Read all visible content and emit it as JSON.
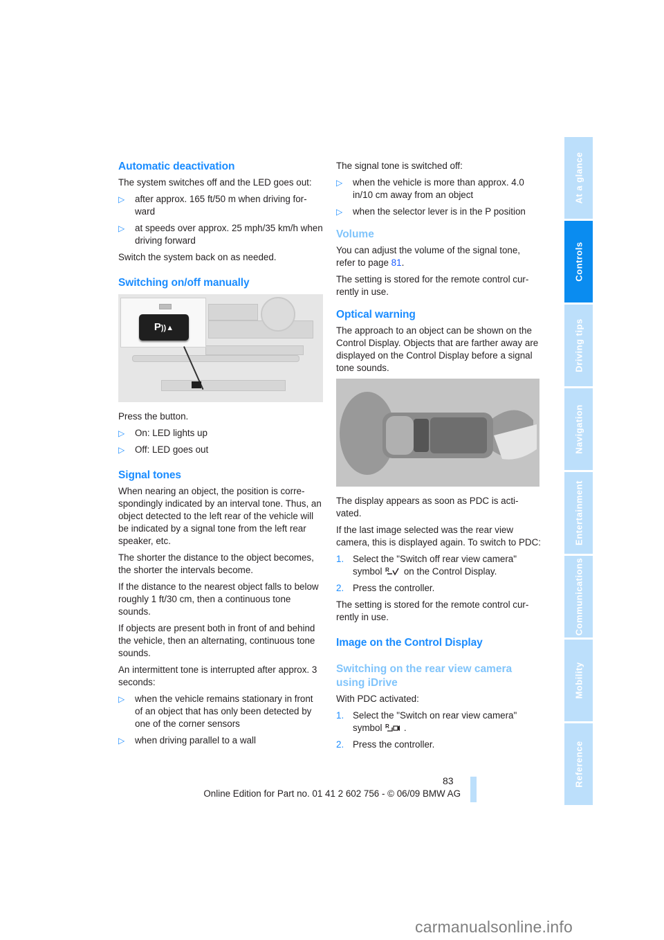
{
  "left_column": {
    "auto_deactivation": {
      "heading": "Automatic deactivation",
      "intro": "The system switches off and the LED goes out:",
      "bullets": [
        "after approx. 165 ft/50 m when driving for-ward",
        "at speeds over approx. 25 mph/35 km/h when driving forward"
      ],
      "outro": "Switch the system back on as needed."
    },
    "manual_switch": {
      "heading": "Switching on/off manually",
      "figure": {
        "button_label": "P",
        "button_icon": "pdc-sensor-icon"
      },
      "intro": "Press the button.",
      "bullets": [
        "On: LED lights up",
        "Off: LED goes out"
      ]
    },
    "signal_tones": {
      "heading": "Signal tones",
      "paragraphs": [
        "When nearing an object, the position is corre-spondingly indicated by an interval tone. Thus, an object detected to the left rear of the vehicle will be indicated by a signal tone from the left rear speaker, etc.",
        "The shorter the distance to the object becomes, the shorter the intervals become.",
        "If the distance to the nearest object falls to below roughly 1 ft/30 cm, then a continuous tone sounds.",
        "If objects are present both in front of and behind the vehicle, then an alternating, continuous tone sounds.",
        "An intermittent tone is interrupted after approx. 3 seconds:"
      ],
      "bullets": [
        "when the vehicle remains stationary in front of an object that has only been detected by one of the corner sensors",
        "when driving parallel to a wall"
      ]
    }
  },
  "right_column": {
    "tone_off": {
      "intro": "The signal tone is switched off:",
      "bullets": [
        "when the vehicle is more than approx. 4.0 in/10 cm away from an object",
        "when the selector lever is in the P position"
      ]
    },
    "volume": {
      "heading": "Volume",
      "text_before": "You can adjust the volume of the signal tone, refer to page ",
      "page_ref": "81",
      "text_after": ".",
      "note": "The setting is stored for the remote control cur-rently in use."
    },
    "optical_warning": {
      "heading": "Optical warning",
      "text": "The approach to an object can be shown on the Control Display. Objects that are farther away are displayed on the Control Display before a signal tone sounds.",
      "after_figure": [
        "The display appears as soon as PDC is acti-vated.",
        "If the last image selected was the rear view camera, this is displayed again. To switch to PDC:"
      ],
      "steps": [
        {
          "num": "1.",
          "before": "Select the \"Switch off rear view camera\" symbol ",
          "icon": "switch-off-camera-icon",
          "after": " on the Control Display."
        },
        {
          "num": "2.",
          "text": "Press the controller."
        }
      ],
      "note": "The setting is stored for the remote control cur-rently in use."
    },
    "control_display_image": {
      "heading": "Image on the Control Display",
      "subheading": "Switching on the rear view camera using iDrive",
      "intro": "With PDC activated:",
      "steps": [
        {
          "num": "1.",
          "before": "Select the \"Switch on rear view camera\" symbol ",
          "icon": "switch-on-camera-icon",
          "after": " ."
        },
        {
          "num": "2.",
          "text": "Press the controller."
        }
      ]
    }
  },
  "side_tabs": [
    {
      "label": "At a glance",
      "active": false
    },
    {
      "label": "Controls",
      "active": true
    },
    {
      "label": "Driving tips",
      "active": false
    },
    {
      "label": "Navigation",
      "active": false
    },
    {
      "label": "Entertainment",
      "active": false
    },
    {
      "label": "Communications",
      "active": false
    },
    {
      "label": "Mobility",
      "active": false
    },
    {
      "label": "Reference",
      "active": false
    }
  ],
  "footer": {
    "page_number": "83",
    "edition": "Online Edition for Part no. 01 41 2 602 756 - © 06/09 BMW AG",
    "watermark": "carmanualsonline.info"
  },
  "colors": {
    "heading": "#1a8cff",
    "subheading": "#80c4fb",
    "tab_active": "#0a8cf0",
    "tab_inactive": "#bcdffb"
  }
}
